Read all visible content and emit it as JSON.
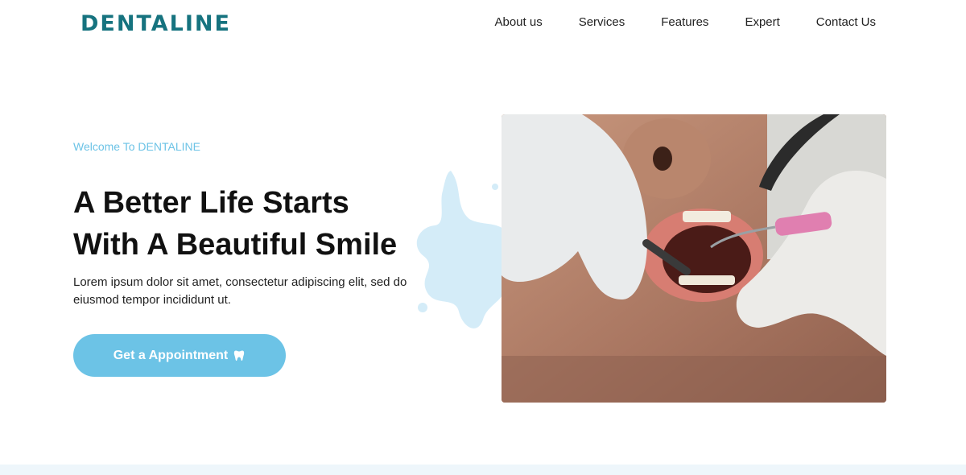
{
  "brand": {
    "logo_text": "DENTALINE",
    "logo_color": "#16737f",
    "accent_color": "#6cc3e6"
  },
  "nav": {
    "items": [
      {
        "label": "About us"
      },
      {
        "label": "Services"
      },
      {
        "label": "Features"
      },
      {
        "label": "Expert"
      },
      {
        "label": "Contact Us"
      }
    ]
  },
  "hero": {
    "welcome": "Welcome To DENTALINE",
    "headline_line1": "A Better Life Starts",
    "headline_line2": "With A Beautiful Smile",
    "description": "Lorem ipsum dolor sit amet, consectetur adipiscing elit, sed do eiusmod tempor incididunt ut.",
    "cta_label": "Get a Appointment",
    "cta_icon": "tooth-icon"
  }
}
